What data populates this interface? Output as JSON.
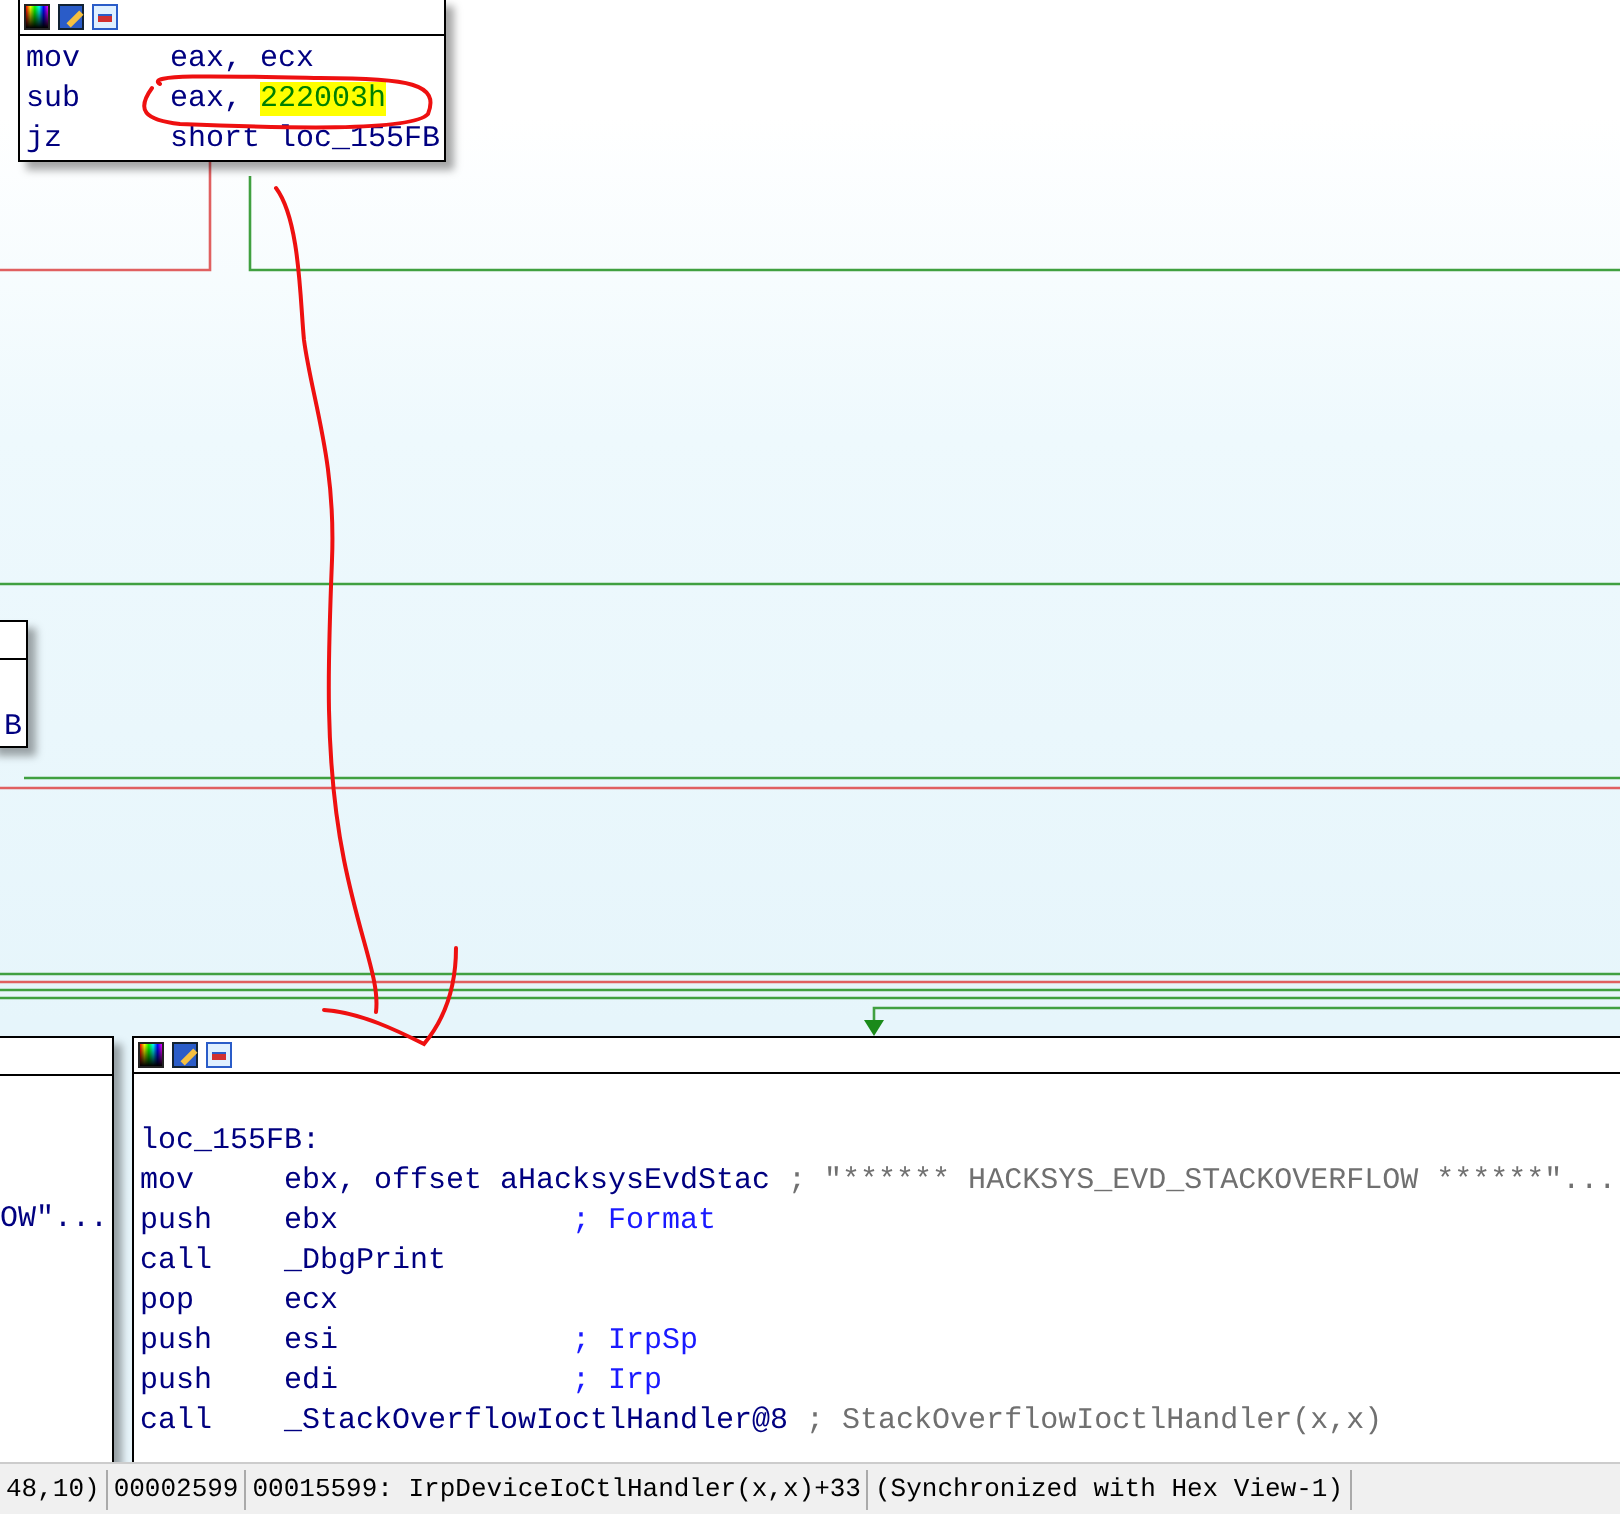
{
  "top_block": {
    "lines": [
      {
        "kind": "instr",
        "mnemonic": "mov",
        "operand": "eax, ecx"
      },
      {
        "kind": "instr",
        "mnemonic": "sub",
        "operand": "eax, ",
        "highlight": "222003h"
      },
      {
        "kind": "instr",
        "mnemonic": "jz",
        "operand": "short loc_155FB"
      }
    ]
  },
  "middle_left_block": {
    "lines": [
      "B"
    ]
  },
  "bottom_left_block": {
    "lines": [
      "OW\"..."
    ]
  },
  "main_block": {
    "lines": [
      {
        "kind": "label",
        "text": "loc_155FB:"
      },
      {
        "kind": "instr",
        "mnemonic": "mov",
        "operand": "ebx, offset aHacksysEvdStac",
        "comment": {
          "kind": "auto",
          "text": "; \"****** HACKSYS_EVD_STACKOVERFLOW ******\"..."
        }
      },
      {
        "kind": "instr",
        "mnemonic": "push",
        "operand": "ebx",
        "comment": {
          "kind": "name",
          "text": "; Format"
        }
      },
      {
        "kind": "instr",
        "mnemonic": "call",
        "operand": "_DbgPrint"
      },
      {
        "kind": "instr",
        "mnemonic": "pop",
        "operand": "ecx"
      },
      {
        "kind": "instr",
        "mnemonic": "push",
        "operand": "esi",
        "comment": {
          "kind": "name",
          "text": "; IrpSp"
        }
      },
      {
        "kind": "instr",
        "mnemonic": "push",
        "operand": "edi",
        "comment": {
          "kind": "name",
          "text": "; Irp"
        }
      },
      {
        "kind": "instr",
        "mnemonic": "call",
        "operand": "_StackOverflowIoctlHandler@8",
        "comment": {
          "kind": "auto",
          "text": "; StackOverflowIoctlHandler(x,x)"
        }
      }
    ]
  },
  "status_bar": [
    "48,10)",
    "00002599",
    "00015599: IrpDeviceIoCtlHandler(x,x)+33",
    "(Synchronized with Hex View-1)"
  ]
}
